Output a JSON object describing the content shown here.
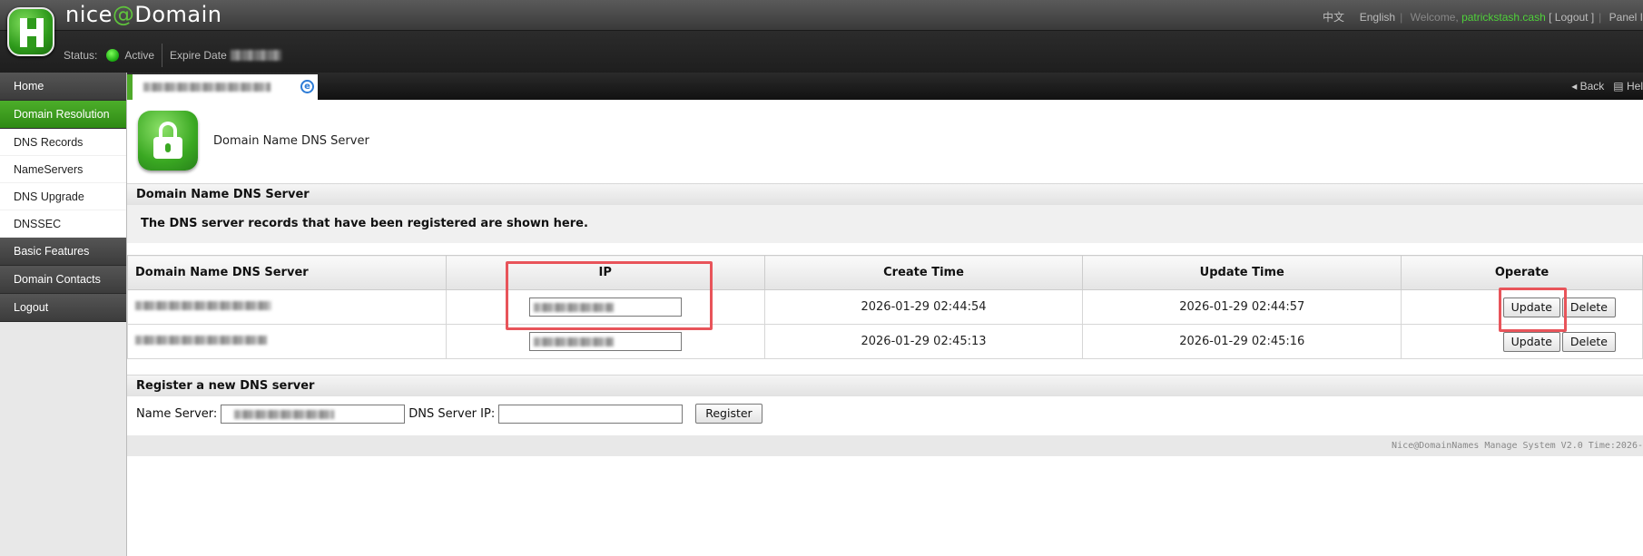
{
  "header": {
    "brand_prefix": "nice",
    "brand_at": "@",
    "brand_suffix": "Domain",
    "status_label": "Status:",
    "status_value": "Active",
    "expire_label": "Expire Date",
    "lang_zh": "中文",
    "lang_en": "English",
    "welcome": "Welcome,",
    "username": "patrickstash.cash",
    "logout": "[ Logout ]",
    "panel": "Panel I",
    "status_color": "#18a80f"
  },
  "sidebar": {
    "items": [
      {
        "label": "Home"
      },
      {
        "label": "Domain Resolution"
      },
      {
        "label": "DNS Records"
      },
      {
        "label": "NameServers"
      },
      {
        "label": "DNS Upgrade"
      },
      {
        "label": "DNSSEC"
      },
      {
        "label": "Basic Features"
      },
      {
        "label": "Domain Contacts"
      },
      {
        "label": "Logout"
      }
    ]
  },
  "tabbar": {
    "back": "Back",
    "help": "Hel"
  },
  "page": {
    "title": "Domain Name DNS Server",
    "section_title": "Domain Name DNS Server",
    "description": "The DNS server records that have been registered are shown here."
  },
  "table": {
    "headers": [
      "Domain Name DNS Server",
      "IP",
      "Create Time",
      "Update Time",
      "Operate"
    ],
    "rows": [
      {
        "create_time": "2026-01-29 02:44:54",
        "update_time": "2026-01-29 02:44:57",
        "update": "Update",
        "delete": "Delete"
      },
      {
        "create_time": "2026-01-29 02:45:13",
        "update_time": "2026-01-29 02:45:16",
        "update": "Update",
        "delete": "Delete"
      }
    ]
  },
  "register": {
    "section_title": "Register a new DNS server",
    "name_server_label": "Name Server:",
    "ip_label": "DNS Server IP:",
    "button": "Register"
  },
  "footer": {
    "text": "Nice@DomainNames Manage System V2.0 Time:2026-"
  },
  "accent": {
    "green": "#3aa822",
    "highlight": "#e8545a"
  }
}
